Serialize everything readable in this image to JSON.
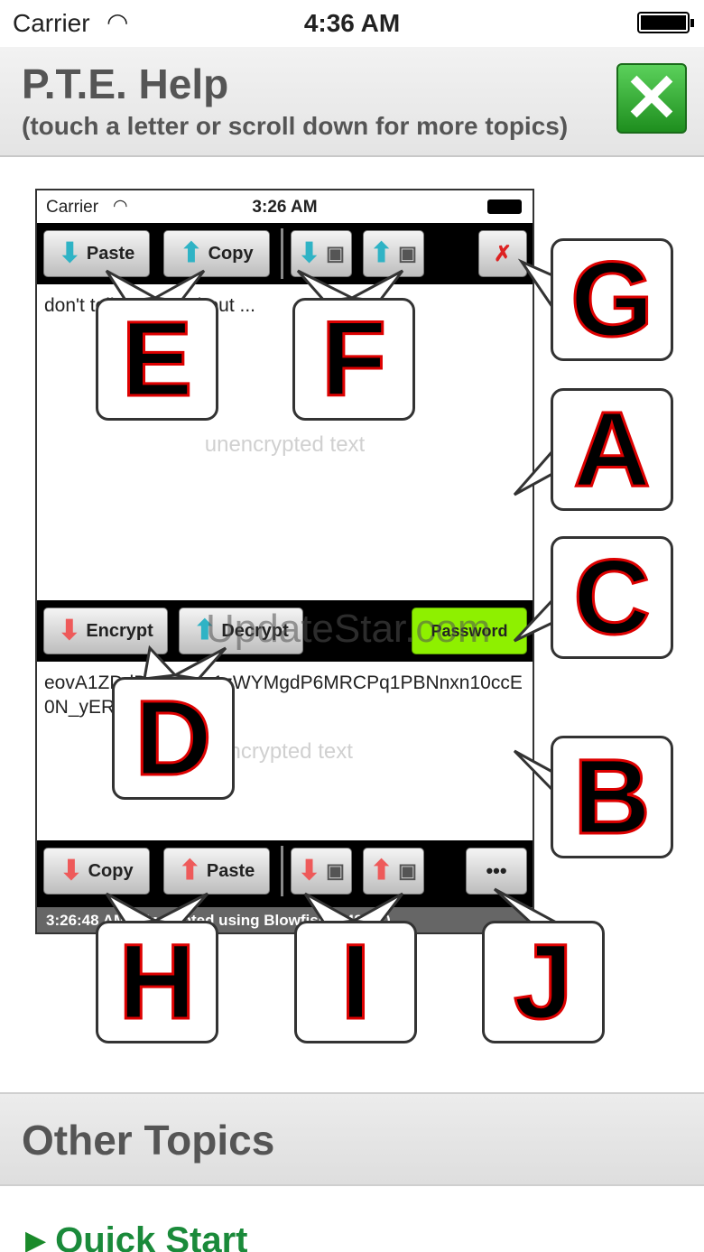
{
  "status_bar": {
    "carrier": "Carrier",
    "time": "4:36 AM"
  },
  "header": {
    "title": "P.T.E. Help",
    "subtitle": "(touch a letter or scroll down for more topics)"
  },
  "screenshot": {
    "status_bar": {
      "carrier": "Carrier",
      "time": "3:26 AM"
    },
    "top_toolbar": {
      "paste_label": "Paste",
      "copy_label": "Copy"
    },
    "unencrypted": {
      "text": "don't tell anyone about ...",
      "placeholder": "unencrypted text"
    },
    "middle_toolbar": {
      "encrypt_label": "Encrypt",
      "decrypt_label": "Decrypt",
      "password_label": "Password"
    },
    "encrypted": {
      "text": "eovA1ZDdDyHimEc1zWYMgdP6MRCPq1PBNnxn10ccE0N_yERxd8olg..m",
      "placeholder": "encrypted text"
    },
    "bottom_toolbar": {
      "copy_label": "Copy",
      "paste_label": "Paste",
      "more_label": "•••"
    },
    "status_line": "3:26:48 AM | Encrypted using Blowfish (448 bit)"
  },
  "callouts": [
    "G",
    "A",
    "C",
    "B",
    "E",
    "F",
    "D",
    "H",
    "I",
    "J"
  ],
  "watermark": "UpdateStar.com",
  "other_topics": {
    "title": "Other Topics",
    "items": [
      {
        "label": "Quick Start"
      }
    ]
  },
  "colors": {
    "accent_green": "#1a8a3a",
    "password_green": "#8ef000",
    "callout_red": "#dd0000"
  }
}
